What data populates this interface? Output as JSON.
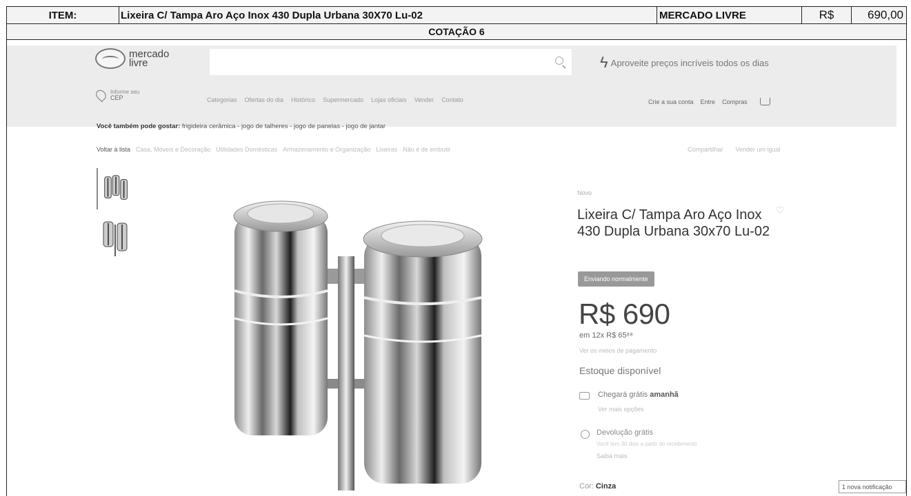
{
  "quote": {
    "item_label": "ITEM:",
    "item_desc": "Lixeira C/ Tampa Aro Aço Inox 430 Dupla Urbana 30X70 Lu-02",
    "store": "MERCADO LIVRE",
    "currency": "R$",
    "price": "690,00",
    "quote_title": "COTAÇÃO 6"
  },
  "nav": {
    "logo_line1": "mercado",
    "logo_line2": "livre",
    "promo": "Aproveite preços incríveis todos os dias",
    "cep_small": "Informe seu",
    "cep": "CEP",
    "menu": [
      "Categorias",
      "Ofertas do dia",
      "Histórico",
      "Supermercado",
      "Lojas oficiais",
      "Vender",
      "Contato"
    ],
    "account": [
      "Crie a sua conta",
      "Entre",
      "Compras"
    ]
  },
  "suggest": {
    "label": "Você também pode gostar:",
    "items": "frigideira cerâmica - jogo de talheres - jogo de panelas - jogo de jantar"
  },
  "breadcrumb": {
    "back": "Voltar à lista",
    "items": [
      "Casa, Móveis e Decoração",
      "Utilidades Domésticas",
      "Armazenamento e Organização",
      "Lixeiras",
      "Não é de embutir"
    ],
    "share": "Compartilhar",
    "sell": "Vender um igual"
  },
  "product": {
    "brand": "Novo",
    "title": "Lixeira C/ Tampa Aro Aço Inox 430 Dupla Urbana 30x70 Lu-02",
    "badge": "Enviando normalmente",
    "price": "R$ 690",
    "installments": "em 12x R$ 65⁸⁸",
    "payment_link": "Ver os meios de pagamento",
    "stock": "Estoque disponível",
    "shipping_pre": "Chegará grátis ",
    "shipping_day": "amanhã",
    "shipping_more": "Ver mais opções",
    "return_title": "Devolução grátis",
    "return_fine": "Você tem 30 dias a partir do recebimento",
    "return_more": "Saiba mais",
    "color_label": "Cor: ",
    "color_value": "Cinza",
    "notification": "1 nova notificação"
  },
  "colors": {
    "nav_bg": "#ececec",
    "steel": "#b9b9b9"
  }
}
